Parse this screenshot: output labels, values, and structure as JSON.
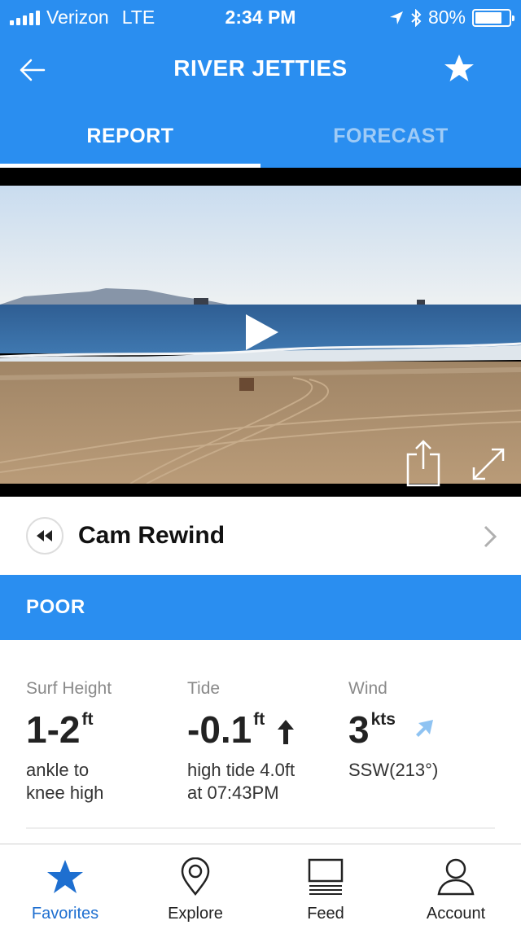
{
  "status_bar": {
    "carrier": "Verizon",
    "network": "LTE",
    "time": "2:34 PM",
    "battery": "80%",
    "battery_level": 0.8
  },
  "header": {
    "title": "RIVER JETTIES",
    "back_icon": "back-arrow-icon",
    "favorite_icon": "star-icon"
  },
  "tabs": [
    {
      "label": "REPORT",
      "active": true
    },
    {
      "label": "FORECAST",
      "active": false
    }
  ],
  "cam": {
    "play_icon": "play-icon",
    "share_icon": "share-icon",
    "fullscreen_icon": "expand-icon"
  },
  "cam_rewind": {
    "label": "Cam Rewind"
  },
  "rating": {
    "label": "POOR",
    "color": "#2a8ef0"
  },
  "conditions": {
    "surf": {
      "label": "Surf Height",
      "value": "1-2",
      "unit": "ft",
      "desc": "ankle to knee high"
    },
    "tide": {
      "label": "Tide",
      "value": "-0.1",
      "unit": "ft",
      "desc_line1": "high tide 4.0ft",
      "desc_line2": "at 07:43PM",
      "trend": "rising"
    },
    "wind": {
      "label": "Wind",
      "value": "3",
      "unit": "kts",
      "desc": "SSW(213°)"
    }
  },
  "tab_bar": [
    {
      "label": "Favorites",
      "icon": "star-icon",
      "active": true
    },
    {
      "label": "Explore",
      "icon": "map-pin-icon",
      "active": false
    },
    {
      "label": "Feed",
      "icon": "feed-icon",
      "active": false
    },
    {
      "label": "Account",
      "icon": "person-icon",
      "active": false
    }
  ],
  "colors": {
    "brand_blue": "#2a8ef0",
    "active_tab": "#1e6fd0",
    "inactive_tab_text": "#9fcbf6"
  }
}
